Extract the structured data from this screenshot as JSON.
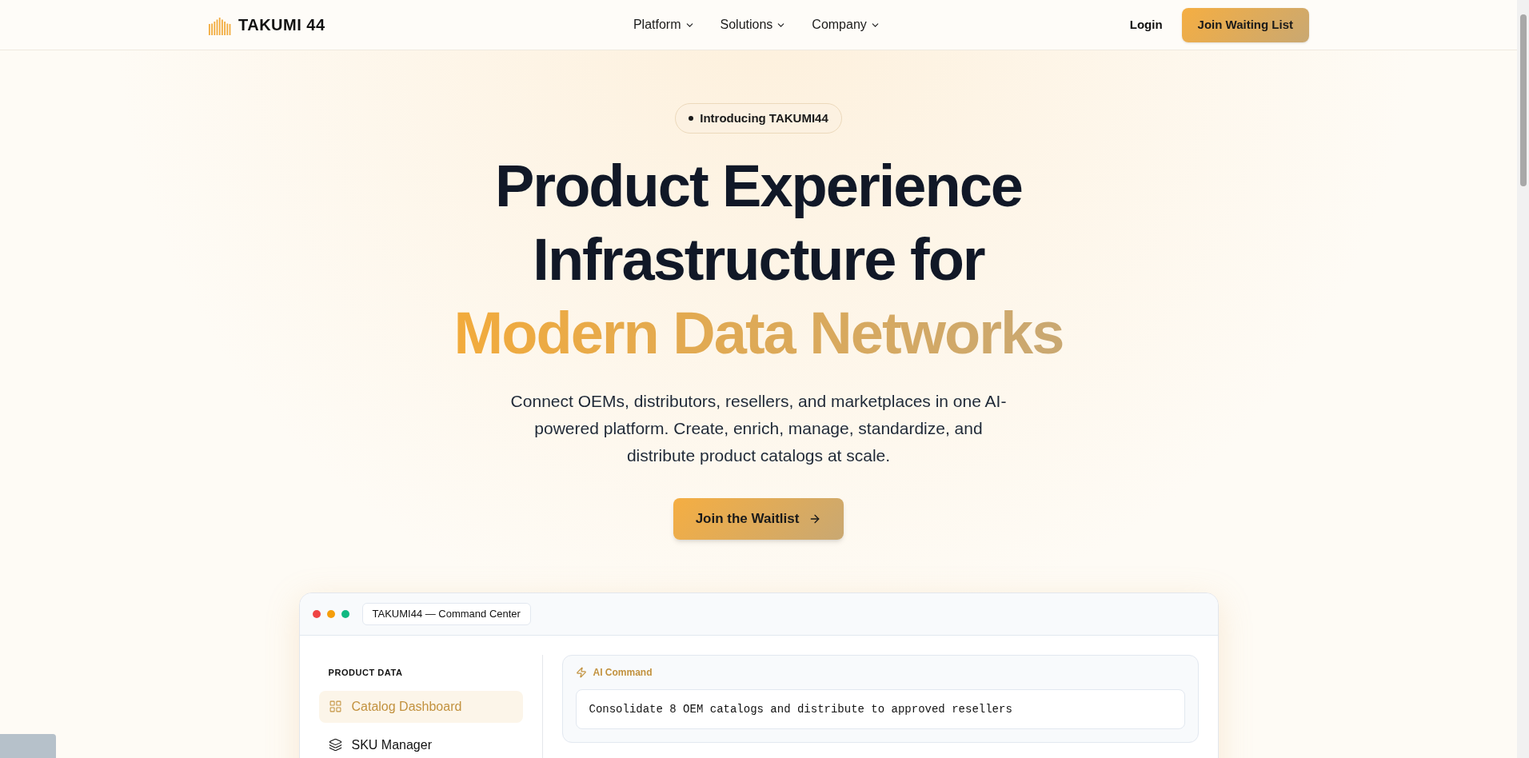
{
  "nav": {
    "brand": "TAKUMI 44",
    "menus": [
      {
        "label": "Platform"
      },
      {
        "label": "Solutions"
      },
      {
        "label": "Company"
      }
    ],
    "login": "Login",
    "cta": "Join Waiting List"
  },
  "hero": {
    "badge": "Introducing TAKUMI44",
    "title_lines": [
      "Product Experience",
      "Infrastructure for"
    ],
    "title_accent": "Modern Data Networks",
    "subtitle": "Connect OEMs, distributors, resellers, and marketplaces in one AI-powered platform. Create, enrich, manage, standardize, and distribute product catalogs at scale.",
    "button": "Join the Waitlist"
  },
  "app_window": {
    "title": "TAKUMI44 — Command Center",
    "sidebar": {
      "heading": "PRODUCT DATA",
      "items": [
        {
          "label": "Catalog Dashboard",
          "kind": "grid",
          "selected": true
        },
        {
          "label": "SKU Manager",
          "kind": "layers",
          "selected": false
        }
      ]
    },
    "command": {
      "label": "AI Command",
      "value": "Consolidate 8 OEM catalogs and distribute to approved resellers"
    }
  }
}
